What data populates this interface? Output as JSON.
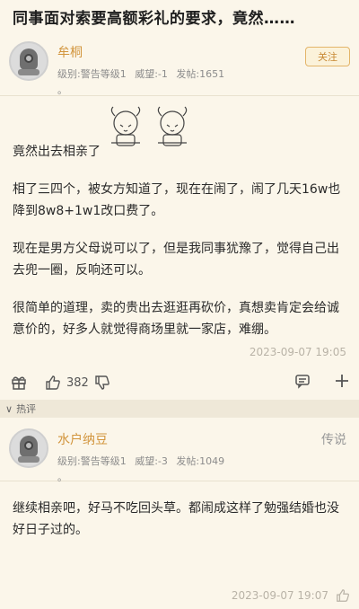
{
  "title": "同事面对索要高额彩礼的要求，竟然……",
  "post": {
    "username": "牟桐",
    "meta": {
      "level": "级别:警告等级1",
      "prestige": "威望:-1",
      "posts": "发帖:1651"
    },
    "dot": "。",
    "follow_label": "关注",
    "paragraphs": [
      "竟然出去相亲了",
      "相了三四个，被女方知道了，现在在闹了，闹了几天16w也降到8w8+1w1改口费了。",
      "现在是男方父母说可以了，但是我同事犹豫了，觉得自己出去兜一圈，反响还可以。",
      "很简单的道理，卖的贵出去逛逛再砍价，真想卖肯定会给诚意价的，好多人就觉得商场里就一家店，难绷。"
    ],
    "timestamp": "2023-09-07 19:05",
    "likes": "382"
  },
  "hot_label": "热评",
  "comment": {
    "username": "水户纳豆",
    "meta": {
      "level": "级别:警告等级1",
      "prestige": "威望:-3",
      "posts": "发帖:1049"
    },
    "dot": "。",
    "badge": "传说",
    "text": "继续相亲吧，好马不吃回头草。都闹成这样了勉强结婚也没好日子过的。",
    "timestamp": "2023-09-07 19:07"
  },
  "icons": {
    "gift": "gift-icon",
    "like": "thumbs-up-icon",
    "dislike": "thumbs-down-icon",
    "comment": "comment-icon",
    "add": "plus-icon",
    "chevron": "chevron-down-icon",
    "avatar": "diving-helmet-avatar"
  },
  "colors": {
    "background": "#fbf6ea",
    "username": "#d2953d",
    "follow_border": "#e3b56a",
    "meta": "#8c8c8c",
    "timestamp": "#b9b3a7"
  }
}
